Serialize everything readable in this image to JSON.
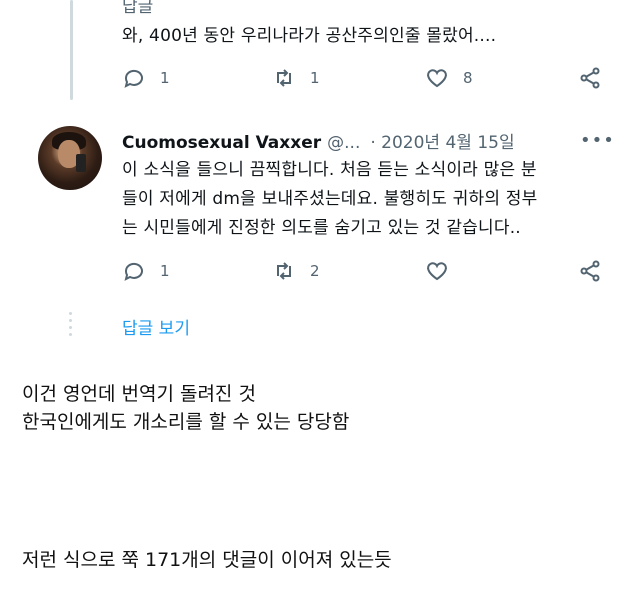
{
  "top_tweet": {
    "reply_label": "답글",
    "text": "와, 400년 동안 우리나라가 공산주의인줄 몰랐어....",
    "actions": {
      "reply_count": "1",
      "retweet_count": "1",
      "like_count": "8"
    }
  },
  "tweet": {
    "display_name": "Cuomosexual Vaxxer",
    "handle": "@...",
    "date": "· 2020년 4월 15일",
    "more": "•••",
    "text_lines": [
      "이 소식을 들으니 끔찍합니다. 처음 듣는 소식이라 많은 분",
      "들이 저에게 dm을 보내주셨는데요. 불행히도 귀하의 정부",
      "는 시민들에게 진정한 의도를 숨기고 있는 것 같습니다.."
    ],
    "actions": {
      "reply_count": "1",
      "retweet_count": "2",
      "like_count": ""
    },
    "show_replies": "답글 보기"
  },
  "caption": {
    "line1": "이건 영언데 번역기 돌려진 것",
    "line2": "한국인에게도 개소리를 할 수 있는 당당함",
    "line3": "저런 식으로 쭉 171개의 댓글이 이어져 있는듯"
  },
  "icons": [
    "reply-icon",
    "retweet-icon",
    "like-icon",
    "share-icon",
    "more-icon"
  ],
  "colors": {
    "accent": "#1d9bf0",
    "muted": "#536471",
    "text": "#0f1419",
    "thread_line": "#cfd9de"
  }
}
